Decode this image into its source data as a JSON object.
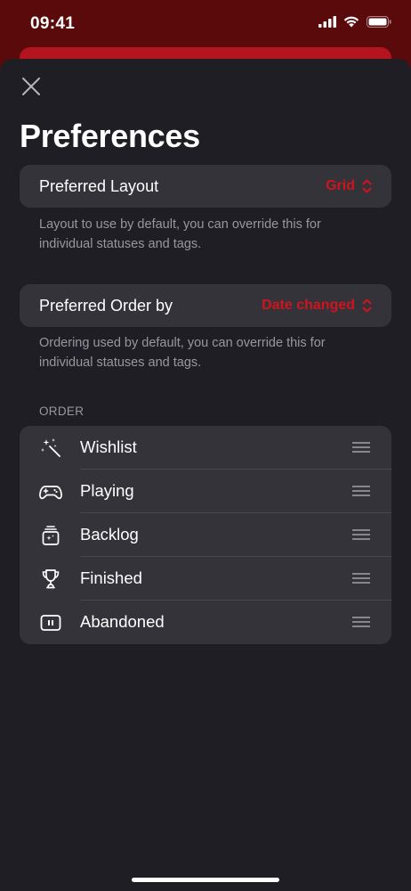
{
  "status_bar": {
    "time": "09:41"
  },
  "sheet": {
    "title": "Preferences",
    "preferred_layout": {
      "label": "Preferred Layout",
      "value": "Grid",
      "footnote": "Layout to use by default, you can override this for individual statuses and tags."
    },
    "preferred_order": {
      "label": "Preferred Order by",
      "value": "Date changed",
      "footnote": "Ordering used by default, you can override this for individual statuses and tags."
    },
    "order_section": {
      "header": "ORDER",
      "items": [
        {
          "label": "Wishlist",
          "icon": "sparkles-wand-icon"
        },
        {
          "label": "Playing",
          "icon": "gamecontroller-icon"
        },
        {
          "label": "Backlog",
          "icon": "backlog-stack-icon"
        },
        {
          "label": "Finished",
          "icon": "trophy-icon"
        },
        {
          "label": "Abandoned",
          "icon": "pause-rectangle-icon"
        }
      ]
    }
  },
  "colors": {
    "accent": "#d0141e",
    "sheet_bg": "#1f1e24",
    "row_bg": "#343339",
    "secondary_text": "#98979e",
    "status_bar_bg": "#5a0a0a"
  }
}
